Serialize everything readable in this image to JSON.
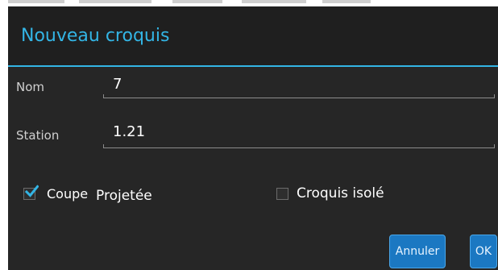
{
  "dialog": {
    "title": "Nouveau croquis",
    "accent_color": "#33b5e5",
    "fields": [
      {
        "label": "Nom",
        "value": "7"
      },
      {
        "label": "Station",
        "value": "1.21"
      }
    ],
    "checkboxes": [
      {
        "label": "Coupe",
        "checked": true,
        "icon": "checkmark-icon"
      },
      {
        "label": "Croquis isolé",
        "checked": false
      }
    ],
    "option_text": "Projetée",
    "buttons": {
      "cancel": "Annuler",
      "ok": "OK",
      "color": "#1b78c2"
    }
  }
}
